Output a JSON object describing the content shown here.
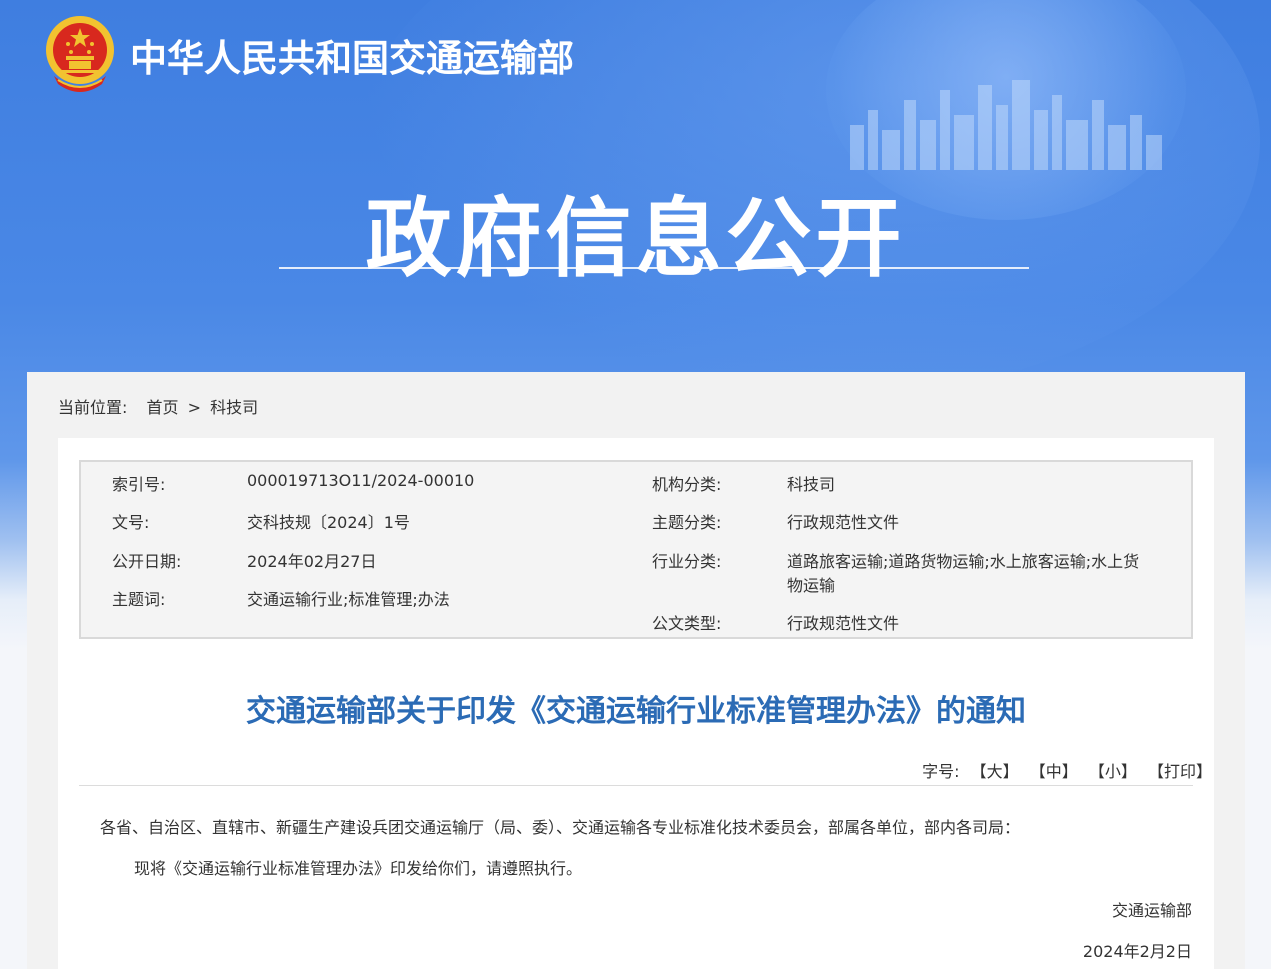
{
  "header": {
    "site_title": "中华人民共和国交通运输部",
    "banner_heading": "政府信息公开"
  },
  "breadcrumb": {
    "prefix": "当前位置:",
    "home": "首页",
    "separator": ">",
    "current": "科技司"
  },
  "meta": {
    "index_label": "索引号:",
    "index_value": "000019713O11/2024-00010",
    "doc_no_label": "文号:",
    "doc_no_value": "交科技规〔2024〕1号",
    "pub_date_label": "公开日期:",
    "pub_date_value": "2024年02月27日",
    "keywords_label": "主题词:",
    "keywords_value": "交通运输行业;标准管理;办法",
    "org_label": "机构分类:",
    "org_value": "科技司",
    "topic_label": "主题分类:",
    "topic_value": "行政规范性文件",
    "industry_label": "行业分类:",
    "industry_value_line1": "道路旅客运输;道路货物运输;水上旅客运输;水上货",
    "industry_value_line2": "物运输",
    "doc_type_label": "公文类型:",
    "doc_type_value": "行政规范性文件"
  },
  "document": {
    "title": "交通运输部关于印发《交通运输行业标准管理办法》的通知",
    "font_size_label": "字号:",
    "font_large": "【大】",
    "font_medium": "【中】",
    "font_small": "【小】",
    "print": "【打印】",
    "addressee": "各省、自治区、直辖市、新疆生产建设兵团交通运输厅（局、委）、交通运输各专业标准化技术委员会，部属各单位，部内各司局：",
    "body": "现将《交通运输行业标准管理办法》印发给你们，请遵照执行。",
    "signature": "交通运输部",
    "date": "2024年2月2日"
  },
  "colors": {
    "banner_blue": "#4a88e6",
    "title_blue": "#2b6bb5",
    "emblem_red": "#d8281e",
    "emblem_gold": "#f2c230"
  }
}
